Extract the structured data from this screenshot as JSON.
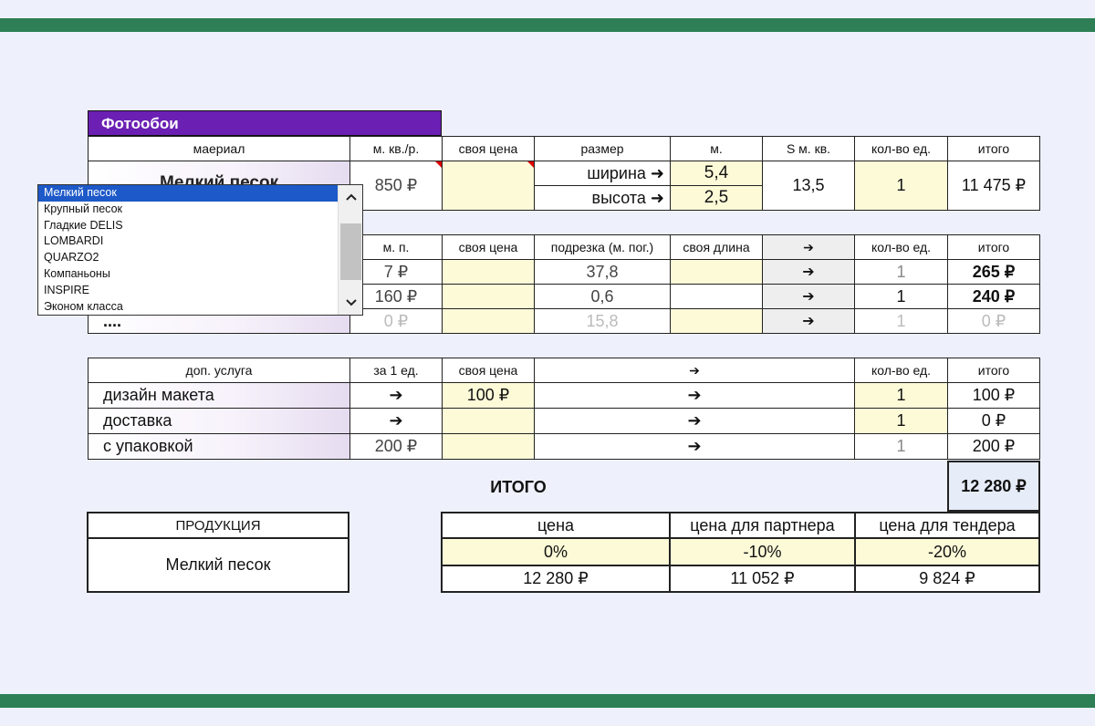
{
  "title": "Фотообои",
  "material": {
    "headers": [
      "маериал",
      "м. кв./р.",
      "своя цена",
      "размер",
      "м.",
      "S м. кв.",
      "кол-во ед.",
      "итого"
    ],
    "selected": "Мелкий песок",
    "price": "850 ₽",
    "own_price": "",
    "width_label": "ширина ➜",
    "height_label": "высота ➜",
    "width": "5,4",
    "height": "2,5",
    "area": "13,5",
    "qty": "1",
    "total": "11 475 ₽"
  },
  "dropdown": {
    "options": [
      "Мелкий песок",
      "Крупный песок",
      "Гладкие DELIS",
      "LOMBARDI",
      "QUARZO2",
      "Компаньоны",
      "INSPIRE",
      "Эконом класса"
    ],
    "selected_index": 0,
    "scroll_up": "^",
    "scroll_down": "v"
  },
  "linear": {
    "headers": [
      "м. п.",
      "своя цена",
      "подрезка (м. пог.)",
      "своя длина",
      "➔",
      "кол-во ед.",
      "итого"
    ],
    "rows": [
      {
        "name": "",
        "mp": "7 ₽",
        "own_price": "",
        "trim": "37,8",
        "own_len": "",
        "arrow": "➔",
        "qty": "1",
        "total": "265 ₽"
      },
      {
        "name": "",
        "mp": "160 ₽",
        "own_price": "",
        "trim": "0,6",
        "own_len": "",
        "arrow": "➔",
        "qty": "1",
        "total": "240 ₽"
      },
      {
        "name": "....",
        "mp": "0 ₽",
        "own_price": "",
        "trim": "15,8",
        "own_len": "",
        "arrow": "➔",
        "qty": "1",
        "total": "0 ₽"
      }
    ]
  },
  "services": {
    "headers": [
      "доп. услуга",
      "за 1 ед.",
      "своя цена",
      "➔",
      "кол-во ед.",
      "итого"
    ],
    "rows": [
      {
        "name": "дизайн макета",
        "unit": "➔",
        "own_price": "100 ₽",
        "arrow": "➔",
        "qty": "1",
        "total": "100 ₽"
      },
      {
        "name": "доставка",
        "unit": "➔",
        "own_price": "",
        "arrow": "➔",
        "qty": "1",
        "total": "0 ₽"
      },
      {
        "name": "с упаковкой",
        "unit": "200 ₽",
        "own_price": "",
        "arrow": "➔",
        "qty": "1",
        "total": "200 ₽"
      }
    ]
  },
  "total": {
    "label": "ИТОГО",
    "value": "12 280 ₽"
  },
  "product": {
    "header": "ПРОДУКЦИЯ",
    "value": "Мелкий песок"
  },
  "prices": {
    "headers": [
      "цена",
      "цена для партнера",
      "цена для тендера"
    ],
    "discounts": [
      "0%",
      "-10%",
      "-20%"
    ],
    "values": [
      "12 280 ₽",
      "11 052 ₽",
      "9 824 ₽"
    ]
  },
  "colors": {
    "band": "#2e7f56",
    "title_bg": "#6b1fb3",
    "yellow": "#fdfad8",
    "selection": "#1d59c8"
  }
}
